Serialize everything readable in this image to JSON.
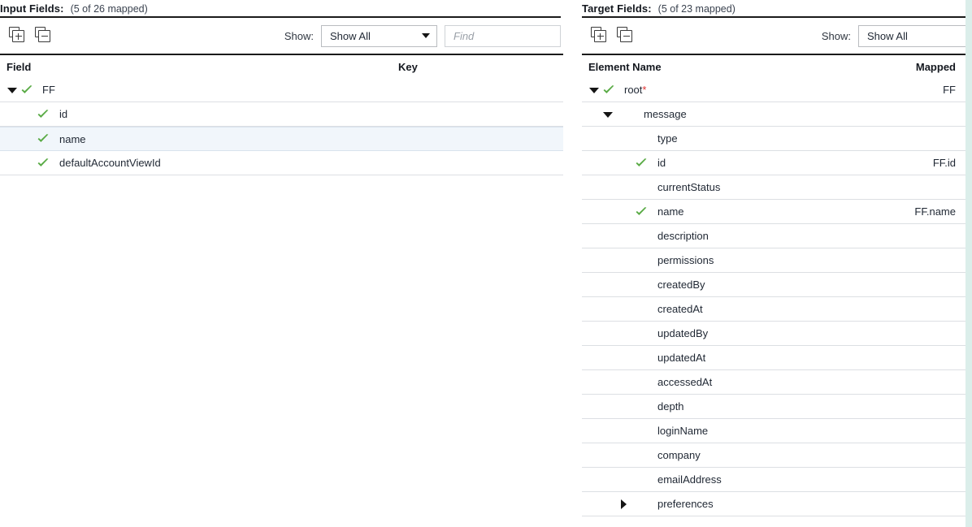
{
  "input_panel": {
    "title": "Input Fields:",
    "summary": "(5 of 26 mapped)",
    "toolbar": {
      "expand_all_icon": "expand-all-icon",
      "collapse_all_icon": "collapse-all-icon",
      "show_label": "Show:",
      "show_value": "Show All",
      "find_placeholder": "Find",
      "find_value": ""
    },
    "columns": {
      "name": "Field",
      "key": "Key"
    },
    "rows": [
      {
        "label": "FF",
        "level": 0,
        "checked": true,
        "expanded": true,
        "key": "",
        "selected": false
      },
      {
        "label": "id",
        "level": 1,
        "checked": true,
        "expanded": null,
        "key": "",
        "selected": false
      },
      {
        "label": "name",
        "level": 1,
        "checked": true,
        "expanded": null,
        "key": "",
        "selected": true
      },
      {
        "label": "defaultAccountViewId",
        "level": 1,
        "checked": true,
        "expanded": null,
        "key": "",
        "selected": false
      }
    ]
  },
  "target_panel": {
    "title": "Target Fields:",
    "summary": "(5 of 23 mapped)",
    "toolbar": {
      "expand_all_icon": "expand-all-icon",
      "collapse_all_icon": "collapse-all-icon",
      "show_label": "Show:",
      "show_value": "Show All"
    },
    "columns": {
      "name": "Element Name",
      "mapped": "Mapped"
    },
    "rows": [
      {
        "label": "root",
        "required": true,
        "level": 0,
        "checked": true,
        "expanded": true,
        "mapped": "FF"
      },
      {
        "label": "message",
        "required": false,
        "level": 1,
        "checked": false,
        "expanded": true,
        "mapped": ""
      },
      {
        "label": "type",
        "required": false,
        "level": 2,
        "checked": false,
        "expanded": null,
        "mapped": ""
      },
      {
        "label": "id",
        "required": false,
        "level": 2,
        "checked": true,
        "expanded": null,
        "mapped": "FF.id"
      },
      {
        "label": "currentStatus",
        "required": false,
        "level": 2,
        "checked": false,
        "expanded": null,
        "mapped": ""
      },
      {
        "label": "name",
        "required": false,
        "level": 2,
        "checked": true,
        "expanded": null,
        "mapped": "FF.name"
      },
      {
        "label": "description",
        "required": false,
        "level": 2,
        "checked": false,
        "expanded": null,
        "mapped": ""
      },
      {
        "label": "permissions",
        "required": false,
        "level": 2,
        "checked": false,
        "expanded": null,
        "mapped": ""
      },
      {
        "label": "createdBy",
        "required": false,
        "level": 2,
        "checked": false,
        "expanded": null,
        "mapped": ""
      },
      {
        "label": "createdAt",
        "required": false,
        "level": 2,
        "checked": false,
        "expanded": null,
        "mapped": ""
      },
      {
        "label": "updatedBy",
        "required": false,
        "level": 2,
        "checked": false,
        "expanded": null,
        "mapped": ""
      },
      {
        "label": "updatedAt",
        "required": false,
        "level": 2,
        "checked": false,
        "expanded": null,
        "mapped": ""
      },
      {
        "label": "accessedAt",
        "required": false,
        "level": 2,
        "checked": false,
        "expanded": null,
        "mapped": ""
      },
      {
        "label": "depth",
        "required": false,
        "level": 2,
        "checked": false,
        "expanded": null,
        "mapped": ""
      },
      {
        "label": "loginName",
        "required": false,
        "level": 2,
        "checked": false,
        "expanded": null,
        "mapped": ""
      },
      {
        "label": "company",
        "required": false,
        "level": 2,
        "checked": false,
        "expanded": null,
        "mapped": ""
      },
      {
        "label": "emailAddress",
        "required": false,
        "level": 2,
        "checked": false,
        "expanded": null,
        "mapped": ""
      },
      {
        "label": "preferences",
        "required": false,
        "level": 2,
        "checked": false,
        "expanded": false,
        "mapped": ""
      }
    ]
  },
  "colors": {
    "check_green": "#5aab46",
    "required_red": "#e03131",
    "selected_row": "#f1f6fb",
    "rule_dark": "#1b1b1b",
    "row_line": "#dcdfe3",
    "scroll_track": "#dbeeea"
  }
}
